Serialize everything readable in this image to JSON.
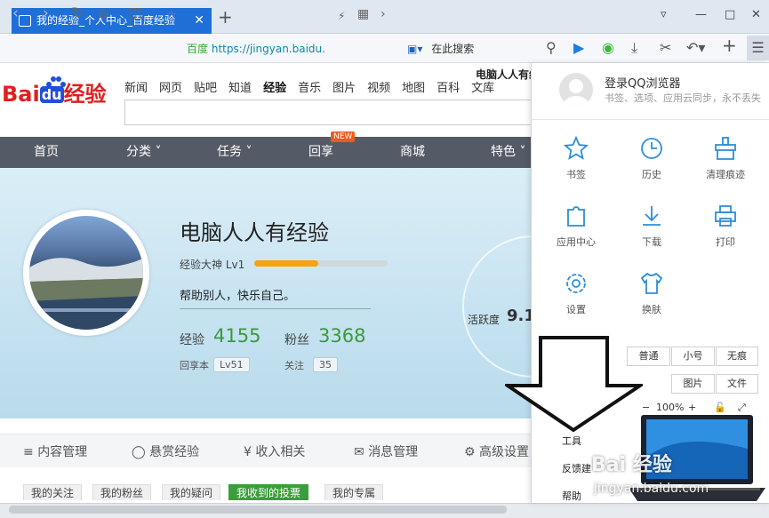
{
  "browser": {
    "tab_title": "我的经验_个人中心_百度经验",
    "tab_close": "✕",
    "new_tab": "+",
    "address_badge": "百度",
    "address_url": "https://jingyan.baidu.",
    "search_placeholder": "在此搜索"
  },
  "site": {
    "logo_text": "Bai",
    "logo_du": "du",
    "logo_tail": "经验",
    "top_nav": [
      "新闻",
      "网页",
      "贴吧",
      "知道",
      "经验",
      "音乐",
      "图片",
      "视频",
      "地图",
      "百科",
      "文库"
    ],
    "active_nav": "经验",
    "username_short": "电脑人人有经",
    "menu": [
      "首页",
      "分类 ˅",
      "任务 ˅",
      "回享",
      "商城",
      "特色 ˅"
    ],
    "new_badge": "NEW"
  },
  "profile": {
    "name": "电脑人人有经验",
    "level_label": "经验大神 Lv1",
    "level_progress": 0.48,
    "motto": "帮助别人，快乐自己。",
    "exp_label": "经验",
    "exp_value": "4155",
    "fans_label": "粉丝",
    "fans_value": "3368",
    "huixiang_label": "回享本",
    "huixiang_level": "Lv51",
    "follow_label": "关注",
    "follow_count": "35",
    "activity_label": "活跃度",
    "activity_value": "9.1"
  },
  "management_tabs": [
    "内容管理",
    "悬赏经验",
    "收入相关",
    "消息管理",
    "高级设置"
  ],
  "sub_tabs": [
    "我的关注",
    "我的粉丝",
    "我的疑问",
    "我收到的投票",
    "我的专属"
  ],
  "menu_panel": {
    "login_title": "登录QQ浏览器",
    "login_sub": "书签、选项、应用云同步，永不丢失",
    "items": [
      {
        "label": "书签",
        "icon": "star-icon"
      },
      {
        "label": "历史",
        "icon": "clock-icon"
      },
      {
        "label": "清理痕迹",
        "icon": "broom-icon"
      },
      {
        "label": "应用中心",
        "icon": "puzzle-icon"
      },
      {
        "label": "下载",
        "icon": "download-icon"
      },
      {
        "label": "打印",
        "icon": "printer-icon"
      },
      {
        "label": "设置",
        "icon": "gear-icon"
      },
      {
        "label": "换肤",
        "icon": "shirt-icon"
      }
    ],
    "mode_buttons": [
      "普通",
      "小号",
      "无痕"
    ],
    "view_buttons": [
      "图片",
      "文件"
    ],
    "zoom_level": "100%",
    "zoom_minus": "−",
    "zoom_plus": "+",
    "tools": "工具",
    "feedback": "反馈建",
    "help": "帮助"
  },
  "watermark": {
    "text": "Bai 经验",
    "url": "jingyan.baidu.com"
  }
}
